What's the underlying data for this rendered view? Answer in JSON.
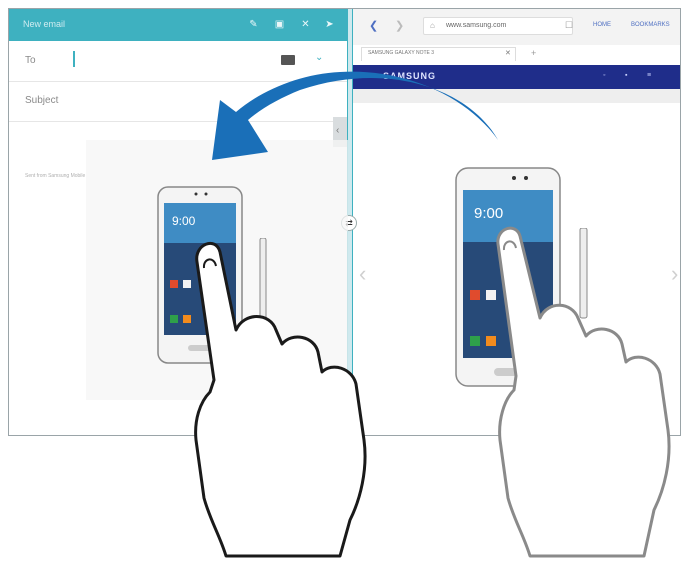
{
  "email": {
    "title": "New email",
    "to_label": "To",
    "subject_label": "Subject",
    "signature": "Sent from Samsung Mobile",
    "header_icons": [
      "attach-icon",
      "save-icon",
      "close-icon",
      "send-icon"
    ]
  },
  "browser": {
    "url": "www.samsung.com",
    "home_label": "HOME",
    "bookmarks_label": "BOOKMARKS",
    "tab_title": "SAMSUNG GALAXY NOTE 3",
    "site_logo": "SAMSUNG"
  },
  "colors": {
    "accent": "#3eb1c0",
    "arrow": "#1a6fb8",
    "site_bar": "#1f2d8a"
  }
}
